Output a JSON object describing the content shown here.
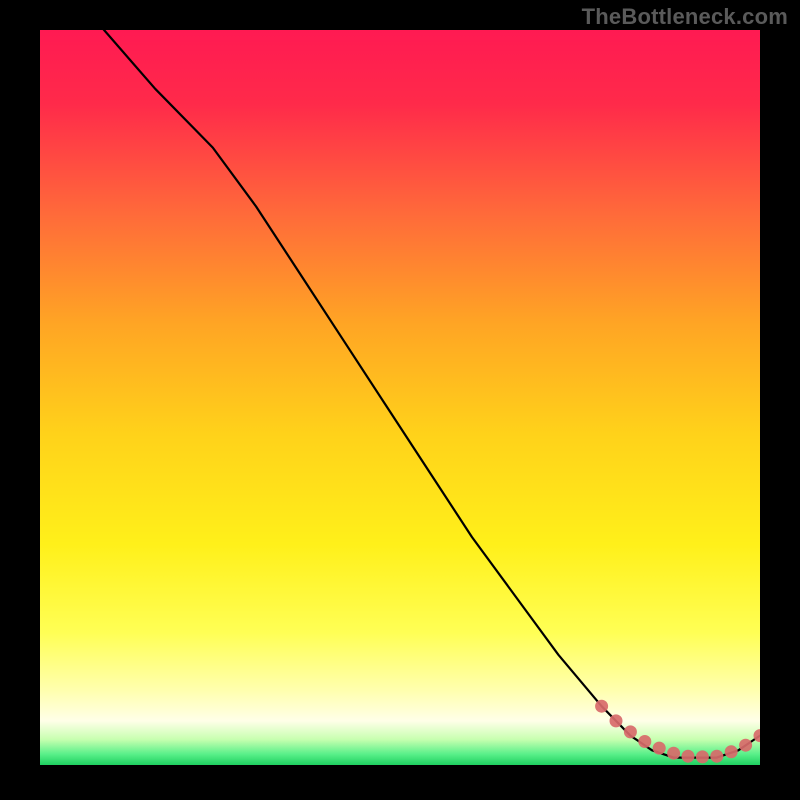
{
  "watermark": "TheBottleneck.com",
  "colors": {
    "bg_black": "#000000",
    "grad_top": "#ff1a52",
    "grad_mid1": "#ff8a2a",
    "grad_mid2": "#ffe61a",
    "grad_mid3": "#ffff66",
    "grad_mid4": "#ffffd0",
    "grad_bottom": "#2adf6b",
    "line": "#000000",
    "marker": "#d86a6a"
  },
  "chart_data": {
    "type": "line",
    "xlabel": "",
    "ylabel": "",
    "xlim": [
      0,
      100
    ],
    "ylim": [
      0,
      100
    ],
    "series": [
      {
        "name": "curve",
        "x": [
          0,
          8,
          16,
          24,
          30,
          36,
          42,
          48,
          54,
          60,
          66,
          72,
          78,
          82,
          85,
          88,
          91,
          94,
          97,
          100
        ],
        "y": [
          110,
          101,
          92,
          84,
          76,
          67,
          58,
          49,
          40,
          31,
          23,
          15,
          8,
          4,
          2,
          1,
          1,
          1,
          2,
          4
        ]
      }
    ],
    "markers": {
      "x": [
        78,
        80,
        82,
        84,
        86,
        88,
        90,
        92,
        94,
        96,
        98,
        100
      ],
      "y": [
        8,
        6,
        4.5,
        3.2,
        2.3,
        1.6,
        1.2,
        1.1,
        1.2,
        1.8,
        2.7,
        4
      ]
    }
  }
}
